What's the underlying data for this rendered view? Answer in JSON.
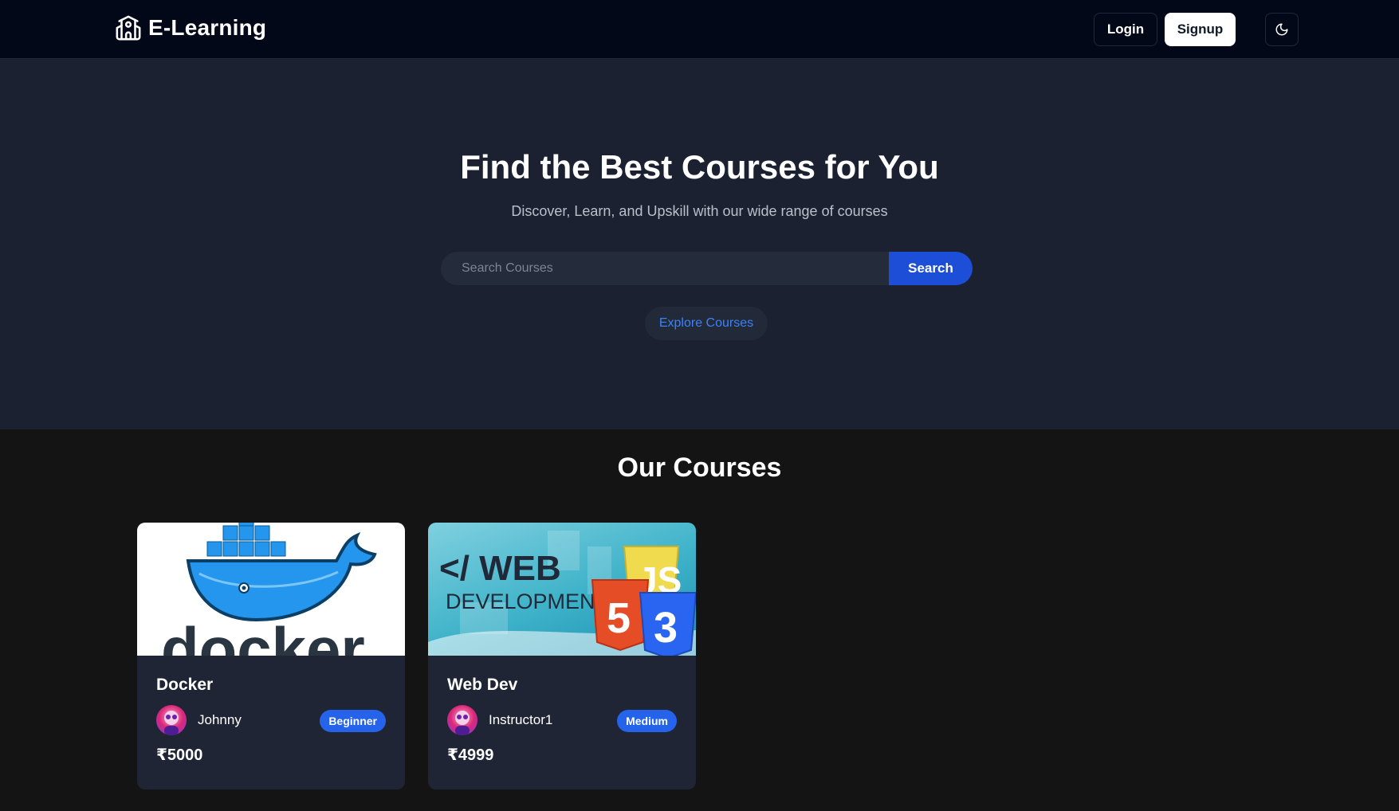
{
  "header": {
    "brand": "E-Learning",
    "login_label": "Login",
    "signup_label": "Signup"
  },
  "hero": {
    "title": "Find the Best Courses for You",
    "subtitle": "Discover, Learn, and Upskill with our wide range of courses",
    "search_placeholder": "Search Courses",
    "search_button": "Search",
    "explore_button": "Explore Courses"
  },
  "courses": {
    "title": "Our Courses",
    "items": [
      {
        "title": "Docker",
        "instructor": "Johnny",
        "level": "Beginner",
        "price": "₹5000",
        "thumb_text": "docker"
      },
      {
        "title": "Web Dev",
        "instructor": "Instructor1",
        "level": "Medium",
        "price": "₹4999",
        "thumb_text_1": "</ WEB",
        "thumb_text_2": "DEVELOPMENT>"
      }
    ]
  },
  "colors": {
    "header_bg": "#020817",
    "hero_bg": "#1b2130",
    "page_bg": "#141414",
    "accent": "#1d4ed8",
    "badge": "#2563eb",
    "card_bg": "#1f2535"
  },
  "icons": {
    "brand": "school-icon",
    "theme": "moon-icon"
  }
}
